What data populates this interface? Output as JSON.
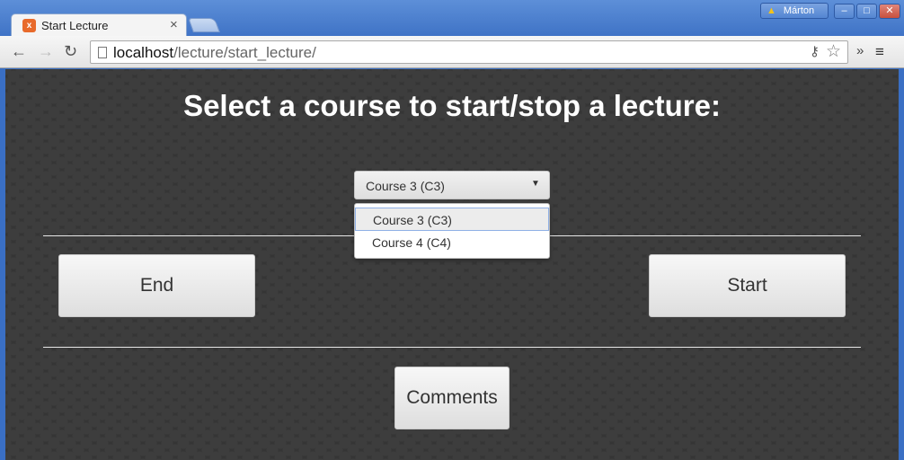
{
  "browser": {
    "tab_title": "Start Lecture",
    "tab_close": "×",
    "favicon": "x",
    "profile_name": "Márton",
    "url_host": "localhost",
    "url_path": "/lecture/start_lecture/"
  },
  "page": {
    "heading": "Select a course to start/stop a lecture:",
    "course_select": {
      "selected": "Course 3 (C3)",
      "options": [
        "Course 3 (C3)",
        "Course 4 (C4)"
      ]
    },
    "buttons": {
      "end": "End",
      "start": "Start",
      "comments": "Comments"
    }
  }
}
